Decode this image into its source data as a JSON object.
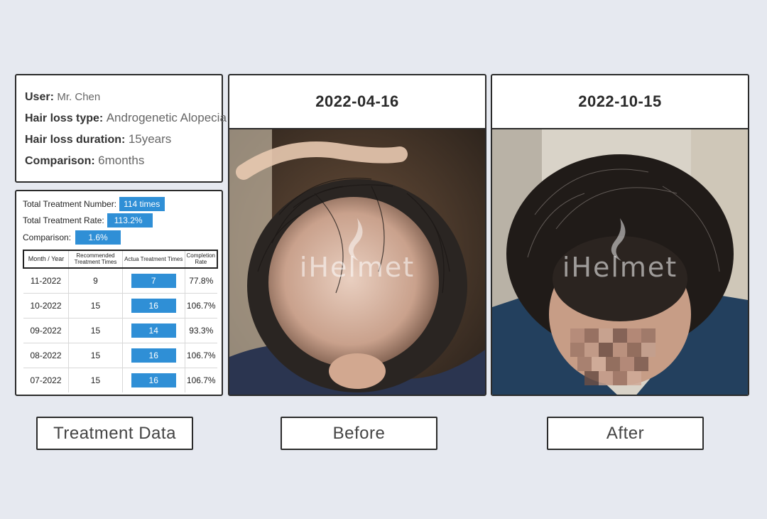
{
  "user_info": {
    "user_key": "User:",
    "user_val": "Mr. Chen",
    "type_key": "Hair loss type:",
    "type_val": "Androgenetic Alopecia",
    "duration_key": "Hair loss duration:",
    "duration_val": "15years",
    "comparison_key": "Comparison:",
    "comparison_val": "6months"
  },
  "treatment": {
    "total_number_label": "Total Treatment Number:",
    "total_number_value": "114 times",
    "total_rate_label": "Total Treatment Rate:",
    "total_rate_value": "113.2%",
    "comparison_label": "Comparison:",
    "comparison_value": "1.6%",
    "headers": [
      "Month / Year",
      "Recommended Treatment Times",
      "Actua Treatment Times",
      "Completion Rate"
    ],
    "rows": [
      {
        "month": "11-2022",
        "recommended": "9",
        "actual": "7",
        "rate": "77.8%"
      },
      {
        "month": "10-2022",
        "recommended": "15",
        "actual": "16",
        "rate": "106.7%"
      },
      {
        "month": "09-2022",
        "recommended": "15",
        "actual": "14",
        "rate": "93.3%"
      },
      {
        "month": "08-2022",
        "recommended": "15",
        "actual": "16",
        "rate": "106.7%"
      },
      {
        "month": "07-2022",
        "recommended": "15",
        "actual": "16",
        "rate": "106.7%"
      }
    ]
  },
  "before": {
    "date": "2022-04-16",
    "watermark": "iHelmet"
  },
  "after": {
    "date": "2022-10-15",
    "watermark": "iHelmet"
  },
  "labels": {
    "treatment": "Treatment Data",
    "before": "Before",
    "after": "After"
  },
  "colors": {
    "accent": "#2f8fd6",
    "background": "#e6e9f0",
    "border": "#2b2b2b"
  }
}
